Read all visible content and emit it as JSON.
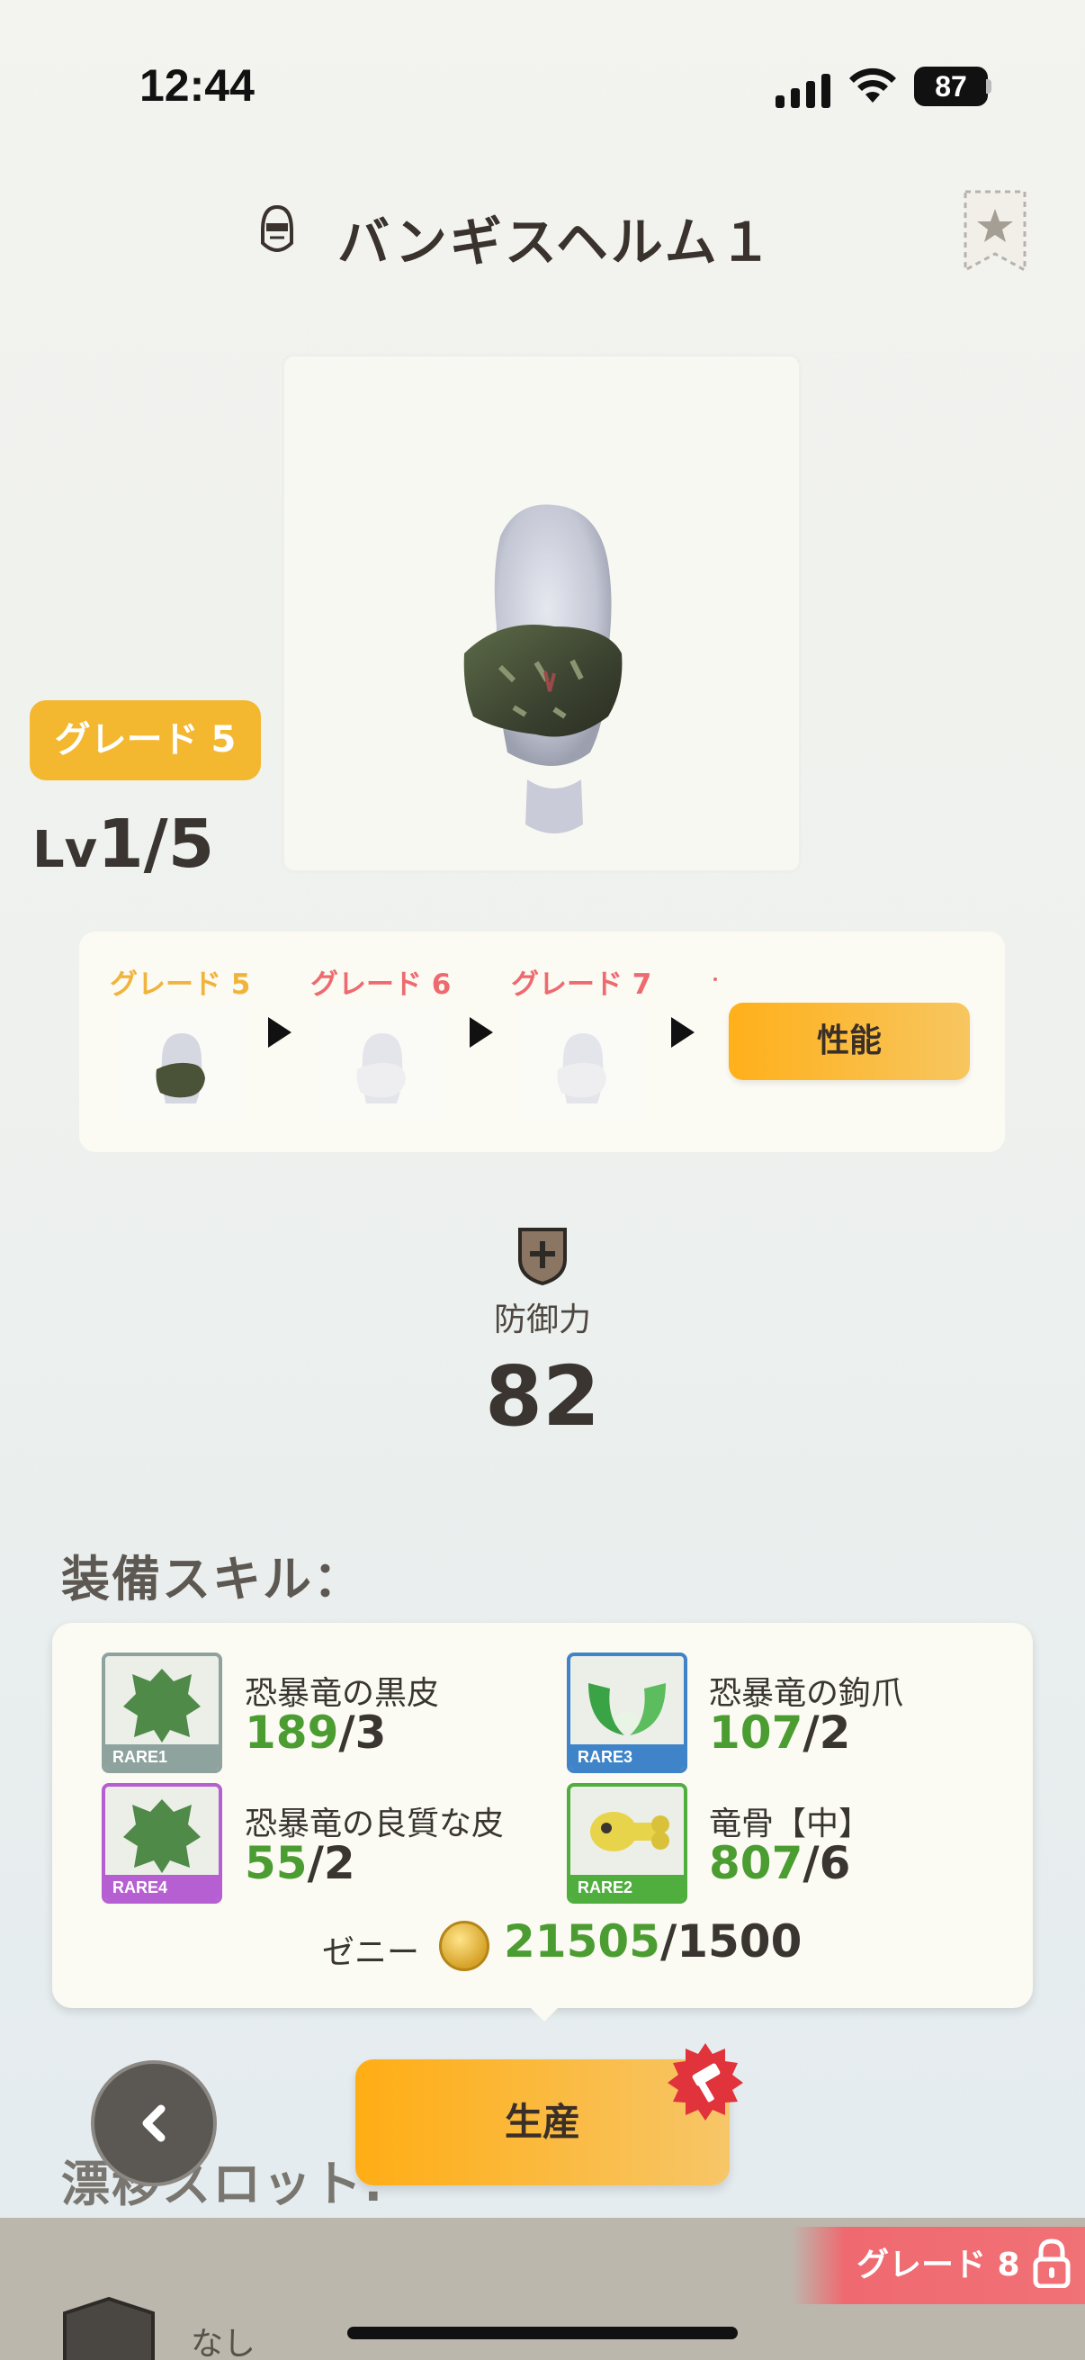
{
  "status_bar": {
    "time": "12:44",
    "battery": "87"
  },
  "title": "バンギスヘルム１",
  "grade": {
    "current_badge": "グレード 5",
    "lv_prefix": "Lv",
    "lv_value": "1/5"
  },
  "grade_path": {
    "items": [
      {
        "label": "グレード 5",
        "color": "#f0b43c"
      },
      {
        "label": "グレード 6",
        "color": "#ee6a6f"
      },
      {
        "label": "グレード 7",
        "color": "#ee6a6f"
      }
    ],
    "performance_button": "性能"
  },
  "defense": {
    "label": "防御力",
    "value": "82"
  },
  "skills_heading": "装備スキル：",
  "materials": [
    {
      "name": "恐暴竜の黒皮",
      "have": "189",
      "need": "/3",
      "rare": "RARE1",
      "rare_color": "#8ea39e",
      "icon": "hide-icon"
    },
    {
      "name": "恐暴竜の鉤爪",
      "have": "107",
      "need": "/2",
      "rare": "RARE3",
      "rare_color": "#3f84c8",
      "icon": "claw-icon"
    },
    {
      "name": "恐暴竜の良質な皮",
      "have": "55",
      "need": "/2",
      "rare": "RARE4",
      "rare_color": "#b65fd2",
      "icon": "hide-icon"
    },
    {
      "name": "竜骨【中】",
      "have": "807",
      "need": "/6",
      "rare": "RARE2",
      "rare_color": "#4fae3e",
      "icon": "bone-icon"
    }
  ],
  "zeny": {
    "label": "ゼニー",
    "have": "21505",
    "need": "/1500"
  },
  "produce_button": "生産",
  "drift_slot_label": "漂移スロット:",
  "locked_grade": "グレード 8",
  "slot_none": "なし",
  "colors": {
    "accent_orange": "#ffad14",
    "have_green": "#4b9d32",
    "locked_red": "#ef6a70"
  }
}
